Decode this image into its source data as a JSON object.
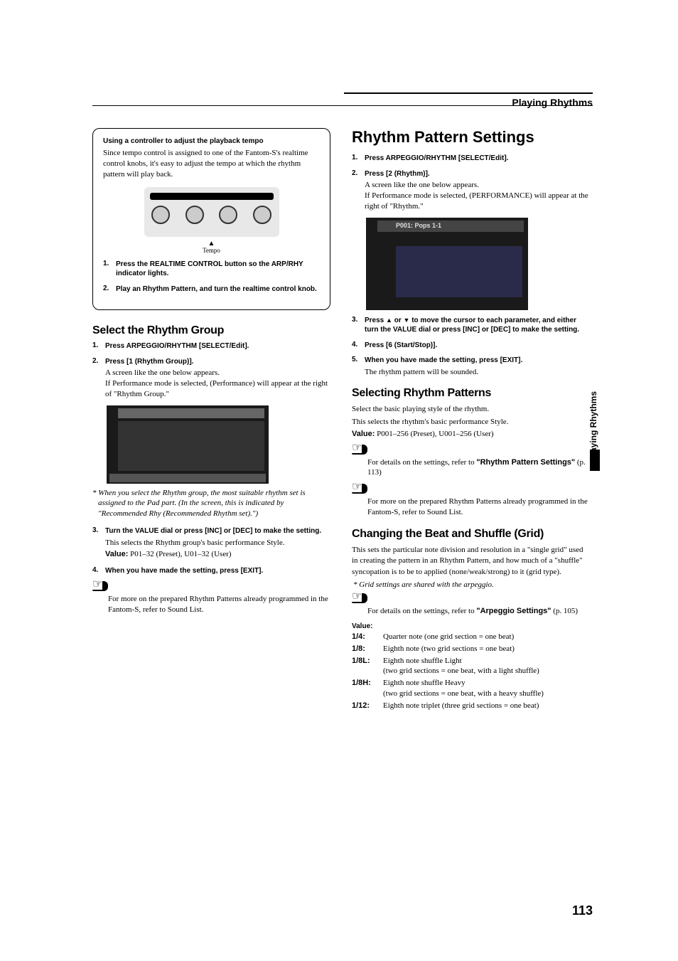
{
  "header": {
    "title": "Playing Rhythms"
  },
  "side_tab": "Playing Rhythms",
  "page_number": "113",
  "left": {
    "callout": {
      "title": "Using a controller to adjust the playback tempo",
      "body": "Since tempo control is assigned to one of the Fantom-S's realtime control knobs, it's easy to adjust the tempo at which the rhythm pattern will play back.",
      "tempo_label": "Tempo",
      "steps": [
        {
          "n": "1.",
          "bold": "Press the REALTIME CONTROL button so the ARP/RHY indicator lights."
        },
        {
          "n": "2.",
          "bold": "Play an Rhythm Pattern, and turn the realtime control knob."
        }
      ]
    },
    "h2": "Select the Rhythm Group",
    "steps": [
      {
        "n": "1.",
        "bold": "Press ARPEGGIO/RHYTHM [SELECT/Edit]."
      },
      {
        "n": "2.",
        "bold": "Press [1 (Rhythm Group)].",
        "text": "A screen like the one below appears.\nIf Performance mode is selected, (Performance) will appear at the right of \"Rhythm Group.\""
      },
      {
        "n": "3.",
        "bold": "Turn the VALUE dial or press [INC] or [DEC] to make the setting.",
        "text": "This selects the Rhythm group's basic performance Style."
      },
      {
        "n": "4.",
        "bold": "When you have made the setting, press [EXIT]."
      }
    ],
    "note_after_screenshot": "When you select the Rhythm group, the most suitable rhythm set is assigned to the Pad part. (In the screen, this is indicated by \"Recommended Rhy (Recommended Rhythm set).\")",
    "value_line": {
      "label": "Value:",
      "text": " P01–32 (Preset), U01–32 (User)"
    },
    "ref1": {
      "text_a": "For more on the prepared Rhythm Patterns already programmed in the Fantom-S, refer to Sound List."
    }
  },
  "right": {
    "h1": "Rhythm Pattern Settings",
    "steps_a": [
      {
        "n": "1.",
        "bold": "Press ARPEGGIO/RHYTHM [SELECT/Edit]."
      },
      {
        "n": "2.",
        "bold": "Press [2 (Rhythm)].",
        "text": "A screen like the one below appears.\nIf Performance mode is selected, (PERFORMANCE) will appear at the right of \"Rhythm.\""
      }
    ],
    "screenshot2_label": "P001: Pops 1-1",
    "steps_b": [
      {
        "n": "3.",
        "bold_pre": "Press ",
        "bold_mid": " or ",
        "bold_post": " to move the cursor to each parameter, and either turn the VALUE dial or press [INC] or [DEC] to make the setting."
      },
      {
        "n": "4.",
        "bold": "Press [6 (Start/Stop)]."
      },
      {
        "n": "5.",
        "bold": "When you have made the setting, press [EXIT].",
        "text": "The rhythm pattern will be sounded."
      }
    ],
    "sec1": {
      "h": "Selecting Rhythm Patterns",
      "p1": "Select the basic playing style of the rhythm.",
      "p2": "This selects the rhythm's basic performance Style.",
      "value": {
        "label": "Value:",
        "text": " P001–256 (Preset), U001–256 (User)"
      },
      "ref1": {
        "pre": "For details on the settings, refer to ",
        "bold": "\"Rhythm Pattern Settings\"",
        "post": " (p. 113)"
      },
      "ref2": "For more on the prepared Rhythm Patterns already programmed in the Fantom-S, refer to Sound List."
    },
    "sec2": {
      "h": "Changing the Beat and Shuffle (Grid)",
      "p": "This sets the particular note division and resolution in a \"single grid\" used in creating the pattern in an Rhythm Pattern, and how much of a \"shuffle\" syncopation is to be to applied (none/weak/strong) to it (grid type).",
      "note": "Grid settings are shared with the arpeggio.",
      "ref": {
        "pre": "For details on the settings, refer to ",
        "bold": "\"Arpeggio Settings\"",
        "post": " (p. 105)"
      },
      "value_heading": "Value:",
      "values": [
        {
          "k": "1/4:",
          "v": "Quarter note (one grid section = one beat)"
        },
        {
          "k": "1/8:",
          "v": "Eighth note (two grid sections = one beat)"
        },
        {
          "k": "1/8L:",
          "v": "Eighth note shuffle Light\n(two grid sections = one beat, with a light shuffle)"
        },
        {
          "k": "1/8H:",
          "v": "Eighth note shuffle Heavy\n(two grid sections = one beat, with a heavy shuffle)"
        },
        {
          "k": "1/12:",
          "v": "Eighth note triplet (three grid sections = one beat)"
        }
      ]
    }
  }
}
